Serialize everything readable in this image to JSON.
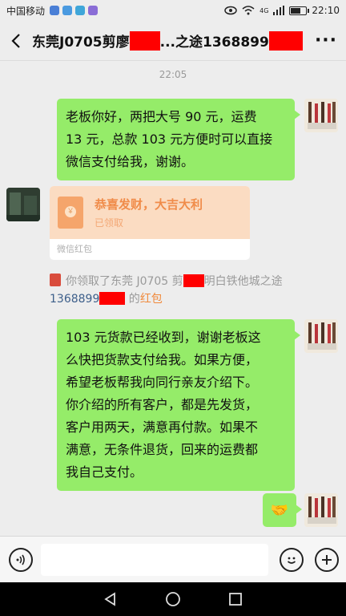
{
  "status_bar": {
    "carrier": "中国移动",
    "network": "4G",
    "time": "22:10"
  },
  "title_bar": {
    "title_part1": "东莞J0705剪廖",
    "title_part2": "...之途1368899"
  },
  "chat": {
    "timestamp": "22:05",
    "msg1": [
      "老板你好，两把大号 90 元，运费",
      "13 元，总款 103 元方便时可以直接",
      "微信支付给我，谢谢。"
    ],
    "red_packet": {
      "title": "恭喜发财，大吉大利",
      "status": "已领取",
      "label": "微信红包",
      "seal": "￥"
    },
    "notice": {
      "text1": "你领取了东莞 J0705 剪",
      "text2": "明白铁他城之途",
      "text3": "1368899",
      "text4": " 的",
      "link": "红包"
    },
    "msg2": [
      "103 元货款已经收到，谢谢老板这",
      "么快把货款支付给我。如果方便，",
      "希望老板帮我向同行亲友介绍下。",
      "你介绍的所有客户，都是先发货，",
      "客户用两天，满意再付款。如果不",
      "满意，无条件退货，回来的运费都",
      "我自己支付。"
    ],
    "msg3_emoji": "🤝"
  },
  "input_bar": {
    "voice_icon": "voice-icon",
    "emoji_icon": "emoji-icon",
    "plus_icon": "plus-icon"
  },
  "colors": {
    "bubble_green": "#95ec69",
    "redact_red": "#ff0000",
    "packet_orange": "#f08c4a"
  }
}
